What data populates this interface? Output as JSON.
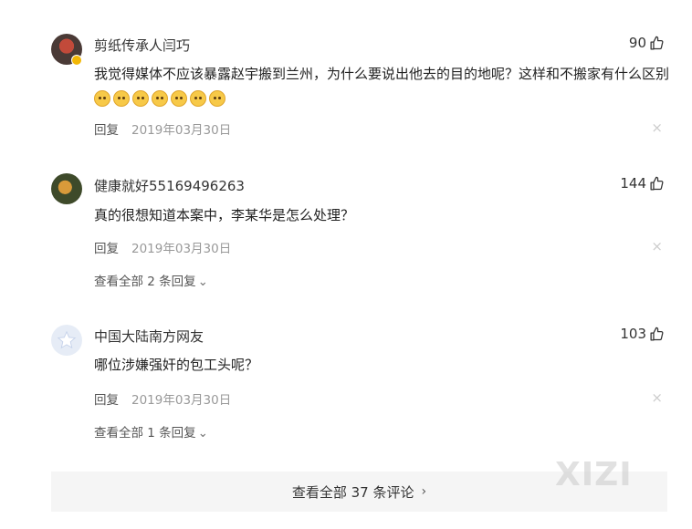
{
  "comments": [
    {
      "username": "剪纸传承人闫巧",
      "likes": "90",
      "text": "我觉得媒体不应该暴露赵宇搬到兰州，为什么要说出他去的目的地呢？这样和不搬家有什么区别",
      "emoji_count": 7,
      "reply_label": "回复",
      "date": "2019年03月30日",
      "close": "×"
    },
    {
      "username": "健康就好55169496263",
      "likes": "144",
      "text": "真的很想知道本案中，李某华是怎么处理？",
      "reply_label": "回复",
      "date": "2019年03月30日",
      "close": "×",
      "view_replies": "查看全部 2 条回复"
    },
    {
      "username": "中国大陆南方网友",
      "likes": "103",
      "text": "哪位涉嫌强奸的包工头呢？",
      "reply_label": "回复",
      "date": "2019年03月30日",
      "close": "×",
      "view_replies": "查看全部 1 条回复"
    }
  ],
  "footer": {
    "view_all": "查看全部 37 条评论"
  },
  "watermark": "XIZI",
  "icons": {
    "like": "thumbs-up-icon",
    "chevron": "chevron-down-icon",
    "footer_chevron": "chevron-right-icon"
  }
}
